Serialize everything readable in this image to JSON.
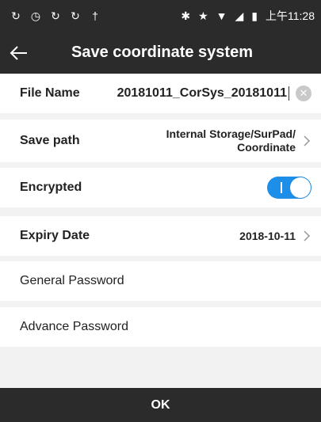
{
  "status_bar": {
    "left_icons": [
      "notification-icon-1",
      "notification-icon-2",
      "notification-icon-3",
      "notification-icon-4",
      "usb-icon"
    ],
    "time": "上午11:28"
  },
  "app_bar": {
    "title": "Save coordinate system"
  },
  "form": {
    "file_name": {
      "label": "File Name",
      "value": "20181011_CorSys_20181011"
    },
    "save_path": {
      "label": "Save path",
      "value_line1": "Internal Storage/SurPad/",
      "value_line2": "Coordinate"
    },
    "encrypted": {
      "label": "Encrypted",
      "on": true
    },
    "expiry_date": {
      "label": "Expiry Date",
      "value": "2018-10-11"
    },
    "general_password": {
      "label": "General Password"
    },
    "advance_password": {
      "label": "Advance Password"
    }
  },
  "footer": {
    "ok_label": "OK"
  },
  "colors": {
    "bar": "#2b2b2b",
    "toggle_on": "#1e8fe8",
    "background": "#f2f2f2"
  }
}
